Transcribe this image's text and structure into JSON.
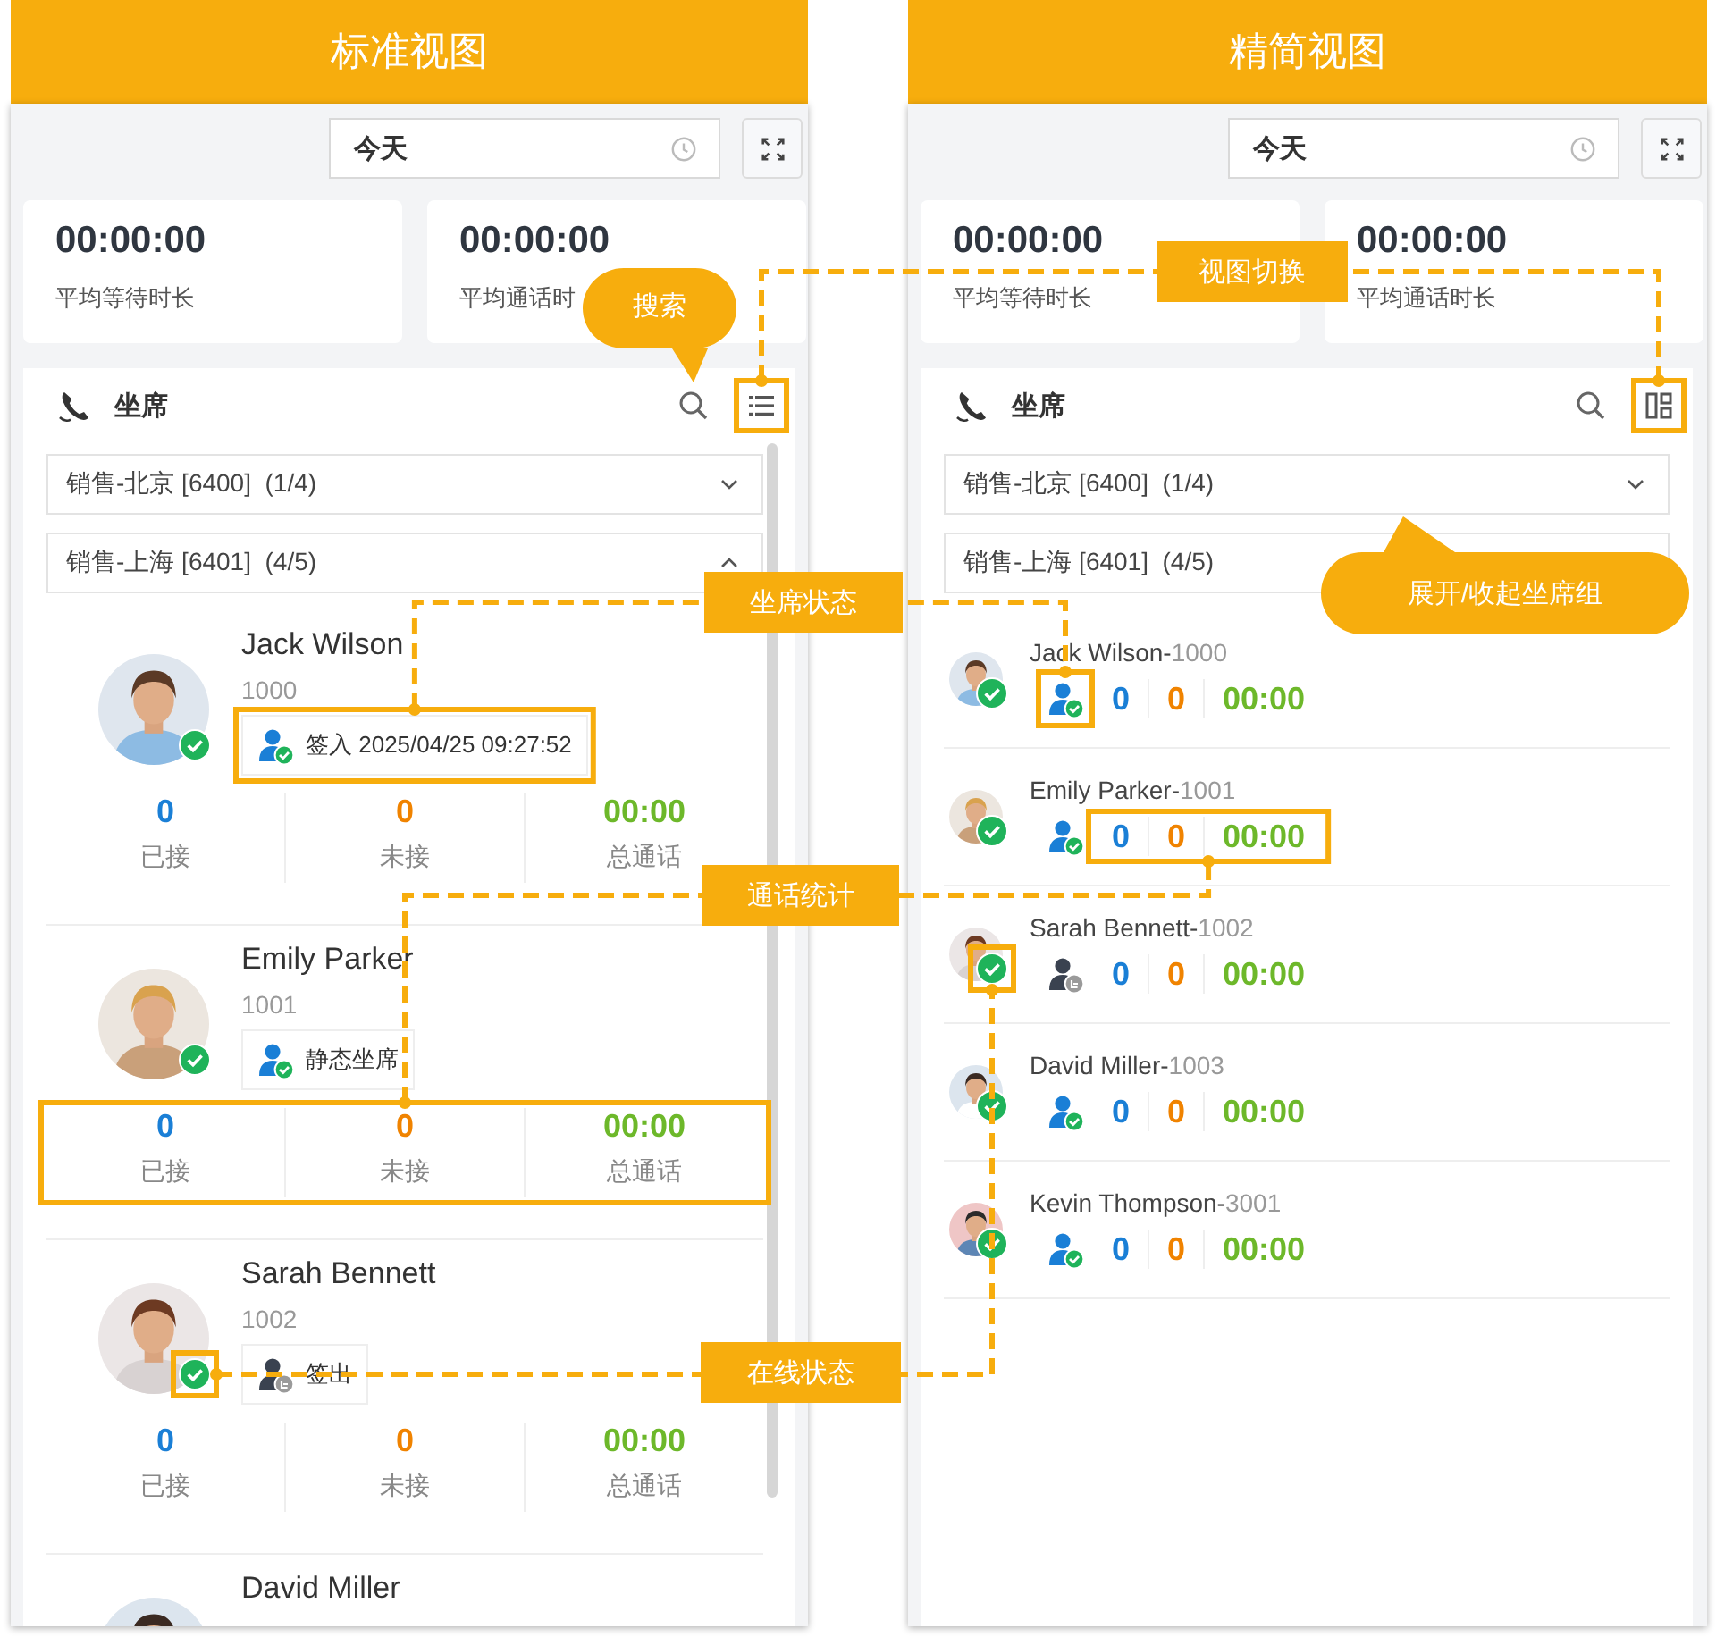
{
  "views": [
    {
      "title": "标准视图",
      "kind": "standard",
      "date_range": {
        "value": "今天"
      },
      "stats": [
        {
          "value": "00:00:00",
          "label": "平均等待时长"
        },
        {
          "value": "00:00:00",
          "label": "平均通话时"
        }
      ],
      "agents_panel": {
        "title": "坐席",
        "groups": [
          {
            "label": "销售-北京 [6400]  (1/4)",
            "expanded": false
          },
          {
            "label": "销售-上海 [6401]  (4/5)",
            "expanded": true
          }
        ],
        "agents": [
          {
            "name": "Jack Wilson",
            "extension": "1000",
            "online": true,
            "status": {
              "kind": "signed-in",
              "text": "签入 2025/04/25 09:27:52"
            },
            "answered": "0",
            "answered_label": "已接",
            "missed": "0",
            "missed_label": "未接",
            "talk_time": "00:00",
            "talk_time_label": "总通话"
          },
          {
            "name": "Emily Parker",
            "extension": "1001",
            "online": true,
            "status": {
              "kind": "static",
              "text": "静态坐席"
            },
            "answered": "0",
            "answered_label": "已接",
            "missed": "0",
            "missed_label": "未接",
            "talk_time": "00:00",
            "talk_time_label": "总通话"
          },
          {
            "name": "Sarah Bennett",
            "extension": "1002",
            "online": true,
            "status": {
              "kind": "signed-out",
              "text": "签出"
            },
            "answered": "0",
            "answered_label": "已接",
            "missed": "0",
            "missed_label": "未接",
            "talk_time": "00:00",
            "talk_time_label": "总通话"
          },
          {
            "name": "David Miller"
          }
        ]
      }
    },
    {
      "title": "精简视图",
      "kind": "compact",
      "date_range": {
        "value": "今天"
      },
      "stats": [
        {
          "value": "00:00:00",
          "label": "平均等待时长"
        },
        {
          "value": "00:00:00",
          "label": "平均通话时长"
        }
      ],
      "agents_panel": {
        "title": "坐席",
        "groups": [
          {
            "label": "销售-北京 [6400]  (1/4)",
            "expanded": false
          },
          {
            "label": "销售-上海 [6401]  (4/5)"
          }
        ],
        "agents": [
          {
            "name": "Jack Wilson-",
            "extension": "1000",
            "online": true,
            "status": {
              "kind": "signed-in"
            },
            "answered": "0",
            "missed": "0",
            "talk_time": "00:00"
          },
          {
            "name": "Emily Parker-",
            "extension": "1001",
            "online": true,
            "status": {
              "kind": "static"
            },
            "answered": "0",
            "missed": "0",
            "talk_time": "00:00"
          },
          {
            "name": "Sarah Bennett-",
            "extension": "1002",
            "online": true,
            "status": {
              "kind": "signed-out"
            },
            "answered": "0",
            "missed": "0",
            "talk_time": "00:00"
          },
          {
            "name": "David Miller-",
            "extension": "1003",
            "online": true,
            "status": {
              "kind": "signed-in"
            },
            "answered": "0",
            "missed": "0",
            "talk_time": "00:00"
          },
          {
            "name": "Kevin Thompson-",
            "extension": "3001",
            "online": true,
            "status": {
              "kind": "signed-in"
            },
            "answered": "0",
            "missed": "0",
            "talk_time": "00:00"
          }
        ]
      }
    }
  ],
  "annotations": [
    {
      "text": "视图切换",
      "kind": "label"
    },
    {
      "text": "搜索",
      "kind": "bubble"
    },
    {
      "text": "坐席状态",
      "kind": "label"
    },
    {
      "text": "展开/收起坐席组",
      "kind": "bubble"
    },
    {
      "text": "通话统计",
      "kind": "label"
    },
    {
      "text": "在线状态",
      "kind": "label"
    }
  ]
}
